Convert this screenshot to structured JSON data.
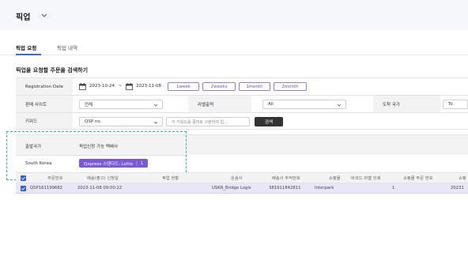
{
  "header": {
    "title": "픽업"
  },
  "tabs": [
    {
      "label": "픽업 요청",
      "active": true
    },
    {
      "label": "픽업 내역",
      "active": false
    }
  ],
  "section_title": "픽업을 요청할 주문을 검색하기",
  "filters": {
    "registration_label": "Registration Date",
    "date_start": "2023-10-24",
    "date_sep": "~",
    "date_end": "2023-11-08",
    "quick_ranges": [
      "1week",
      "2weeks",
      "1month",
      "2month"
    ],
    "sales_site_label": "판매 사이트",
    "sales_site_value": "전체",
    "label_output_label": "라벨출력",
    "label_output_value": "All",
    "arrival_country_label": "도착 국가",
    "arrival_country_value": "To",
    "keyword_label": "키워드",
    "keyword_type_value": "QSP no.",
    "keyword_placeholder": "각 키워드를 콤마로 구분하여 입...",
    "search_label": "검색"
  },
  "carrier": {
    "col_departure": "출발국가",
    "col_carriers": "픽업신청 가능 택배사",
    "departure_value": "South Korea",
    "carrier_name": "Qxpress 스탠다드: Lotte",
    "carrier_count": "1"
  },
  "table": {
    "headers": [
      "주문번호",
      "배송(출고) 신청일",
      "픽업 현황",
      "운송사",
      "배송사 추적번호",
      "쇼핑몰",
      "바코드 라벨 인쇄",
      "쇼핑몰 주문 번호",
      "쇼핑"
    ],
    "rows": [
      [
        "QSP161199682",
        "2023-11-08 09:00:22",
        "",
        "USKR_Bridge Logis",
        "381911842811",
        "Interpark",
        "",
        "1",
        "20231"
      ]
    ]
  },
  "colors": {
    "accent": "#7b58d6",
    "highlight_row": "#e9e6f7",
    "dashed_outline": "#2ab3b0"
  }
}
